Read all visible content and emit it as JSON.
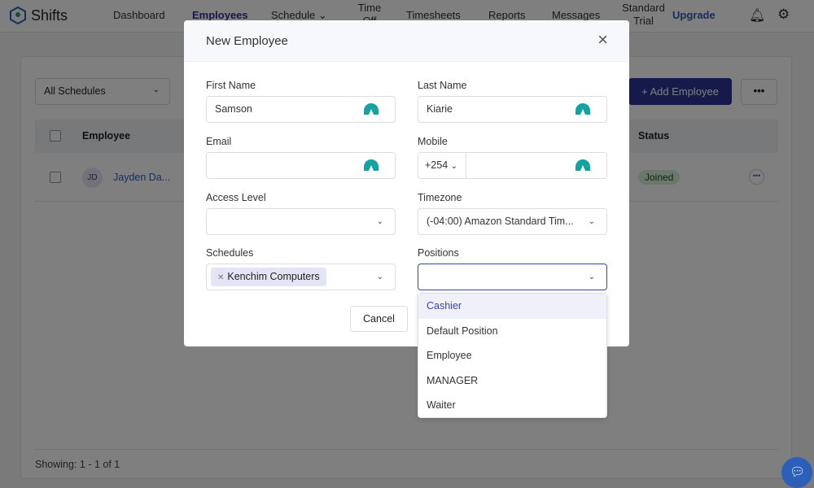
{
  "app": {
    "name": "Shifts"
  },
  "nav": {
    "items": [
      "Dashboard",
      "Employees",
      "Schedule",
      "Time Off",
      "Timesheets",
      "Reports",
      "Messages"
    ],
    "active": "Employees",
    "plan": "Standard Trial",
    "upgrade": "Upgrade"
  },
  "page": {
    "schedule_filter": "All Schedules",
    "add_employee": "+ Add Employee",
    "more": "•••",
    "table": {
      "headers": [
        "Employee",
        "Status"
      ],
      "rows": [
        {
          "initials": "JD",
          "name": "Jayden Da...",
          "status": "Joined"
        }
      ]
    },
    "footer": "Showing: 1 - 1 of 1"
  },
  "modal": {
    "title": "New Employee",
    "close": "×",
    "fields": {
      "first_name": {
        "label": "First Name",
        "value": "Samson"
      },
      "last_name": {
        "label": "Last Name",
        "value": "Kiarie"
      },
      "email": {
        "label": "Email",
        "value": ""
      },
      "mobile": {
        "label": "Mobile",
        "code": "+254",
        "value": ""
      },
      "access_level": {
        "label": "Access Level",
        "value": ""
      },
      "timezone": {
        "label": "Timezone",
        "value": "(-04:00) Amazon Standard Tim..."
      },
      "schedules": {
        "label": "Schedules",
        "chips": [
          "Kenchim Computers"
        ]
      },
      "positions": {
        "label": "Positions",
        "value": ""
      }
    },
    "cancel": "Cancel",
    "positions_options": [
      "Cashier",
      "Default Position",
      "Employee",
      "MANAGER",
      "Waiter"
    ]
  },
  "colors": {
    "brand": "#2b3595",
    "accent_grammarly": "#14a3a0",
    "status_joined": "#d7eed8"
  }
}
